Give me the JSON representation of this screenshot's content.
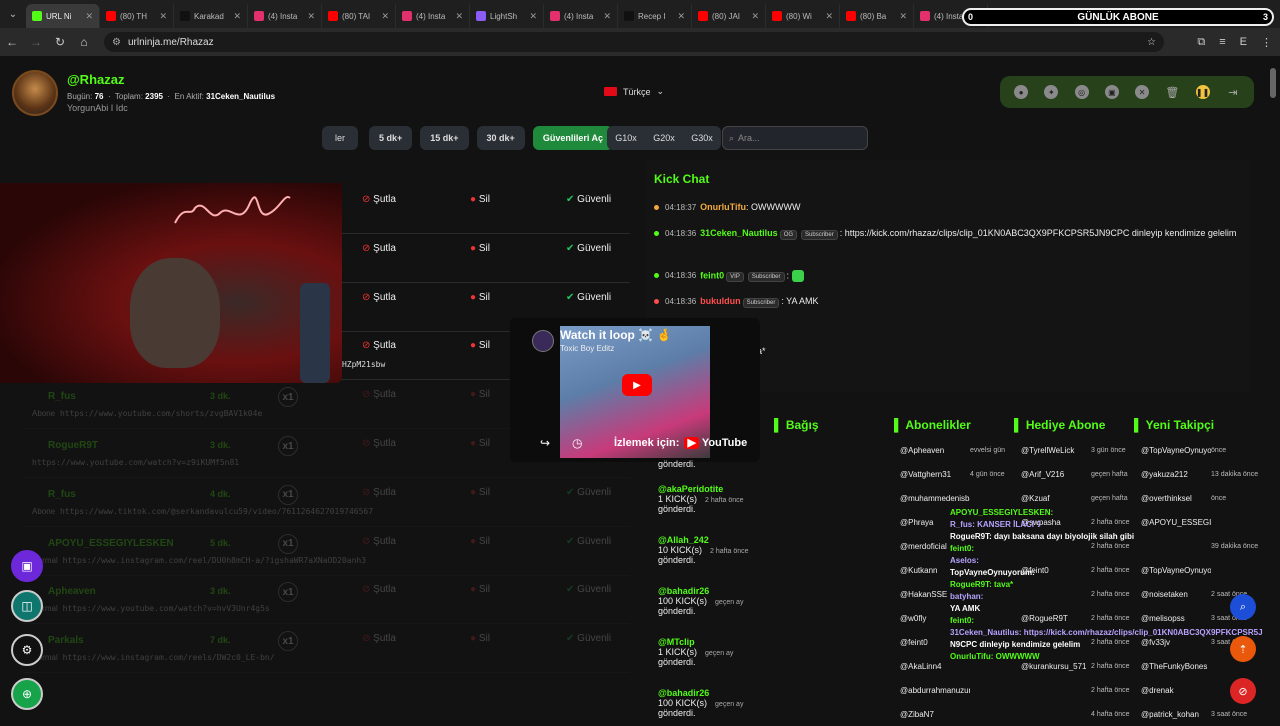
{
  "browser": {
    "tabs": [
      {
        "label": "URL Ni",
        "color": "#53fc18",
        "active": true
      },
      {
        "label": "(80) TH",
        "color": "#ff0000"
      },
      {
        "label": "Karakad",
        "color": "#111"
      },
      {
        "label": "(4) Insta",
        "color": "#e1306c"
      },
      {
        "label": "(80) TAI",
        "color": "#ff0000"
      },
      {
        "label": "(4) Insta",
        "color": "#e1306c"
      },
      {
        "label": "LightSh",
        "color": "#8b5cf6"
      },
      {
        "label": "(4) Insta",
        "color": "#e1306c"
      },
      {
        "label": "Recep I",
        "color": "#111"
      },
      {
        "label": "(80) JAI",
        "color": "#ff0000"
      },
      {
        "label": "(80) Wi",
        "color": "#ff0000"
      },
      {
        "label": "(80) Ba",
        "color": "#ff0000"
      },
      {
        "label": "(4) Insta",
        "color": "#e1306c"
      }
    ],
    "url": "urlninja.me/Rhazaz",
    "overlay_banner": "GÜNLÜK ABONE",
    "overlay_left": "0",
    "overlay_right": "3",
    "profile_initial": "E"
  },
  "header": {
    "username": "@Rhazaz",
    "today_label": "Bugün:",
    "today_value": "76",
    "total_label": "Toplam:",
    "total_value": "2395",
    "active_label": "En Aktif:",
    "active_value": "31Ceken_Nautilus",
    "subtitle": "YorgunAbi I Idc",
    "language": "Türkçe"
  },
  "toolbar": {
    "partial_label": "ler",
    "buttons": [
      "5 dk+",
      "15 dk+",
      "30 dk+"
    ],
    "trust_button": "Güvenlileri Aç",
    "multipliers": [
      "G10x",
      "G20x",
      "G30x"
    ],
    "search_placeholder": "Ara..."
  },
  "actions": {
    "report": "Şutla",
    "delete": "Sil",
    "trust": "Güvenli"
  },
  "rows": [
    {
      "name": "",
      "dk": "",
      "x": "",
      "type": "",
      "link": "9CPC",
      "faded": false
    },
    {
      "name": "",
      "dk": "",
      "x": "",
      "type": "",
      "link": "",
      "faded": false
    },
    {
      "name": "",
      "dk": "",
      "x": "",
      "type": "Normal",
      "link": "https://www.youtube.com/shorts/ombsPbzkgcU",
      "faded": false
    },
    {
      "name": "APOYU_ESSEGIYLESKEN",
      "dk": "2 dk.",
      "x": "x1",
      "type": "Normal",
      "link": "https://www.instagram.com/reel/DR5SWO6CK0o/?igsh=MWs2aWRzeHZpM21sbw",
      "faded": false
    },
    {
      "name": "R_fus",
      "dk": "3 dk.",
      "x": "x1",
      "type": "Abone",
      "link": "https://www.youtube.com/shorts/zvgBAV1k04e",
      "faded": true
    },
    {
      "name": "RogueR9T",
      "dk": "3 dk.",
      "x": "x1",
      "type": "",
      "link": "https://www.youtube.com/watch?v=z9iKUMf5n81",
      "faded": true
    },
    {
      "name": "R_fus",
      "dk": "4 dk.",
      "x": "x1",
      "type": "Abone",
      "link": "https://www.tiktok.com/@serkandavulcu59/video/7611264627019746567",
      "faded": true
    },
    {
      "name": "APOYU_ESSEGIYLESKEN",
      "dk": "5 dk.",
      "x": "x1",
      "type": "Normal",
      "link": "https://www.instagram.com/reel/DU0h8mCH-a/?igshaWR7aXNaOD20anh3",
      "faded": true
    },
    {
      "name": "Apheaven",
      "dk": "3 dk.",
      "x": "x1",
      "type": "Normal",
      "link": "https://www.youtube.com/watch?v=hvV3Unr4g5s",
      "faded": true
    },
    {
      "name": "Parkals",
      "dk": "7 dk.",
      "x": "x1",
      "type": "Normal",
      "link": "https://www.instagram.com/reels/DW2c0_LE-bn/",
      "faded": true
    }
  ],
  "chat": {
    "title": "Kick Chat",
    "messages": [
      {
        "time": "04:18:37",
        "user": "OnurluTifu",
        "color": "#f2a93b",
        "text": ": OWWWWW"
      },
      {
        "time": "04:18:36",
        "user": "31Ceken_Nautilus",
        "color": "#53fc18",
        "badges": [
          "OG",
          "Subscriber"
        ],
        "text": ": https://kick.com/rhazaz/clips/clip_01KN0ABC3QX9PFKCPSR5JN9CPC dinleyip kendimize gelelim"
      },
      {
        "time": "04:18:36",
        "user": "feint0",
        "color": "#53fc18",
        "badges": [
          "VIP",
          "Subscriber"
        ],
        "text": ":"
      },
      {
        "time": "04:18:36",
        "user": "bukuldun",
        "color": "#ff4d4d",
        "badges": [
          "Subscriber"
        ],
        "text": ": YA AMK"
      },
      {
        "time": "",
        "user": "",
        "color": "#ccc",
        "badges": [
          "Subscriber"
        ],
        "text": ":"
      },
      {
        "time": "",
        "user": "",
        "color": "#ccc",
        "badges": [
          "Founder",
          "Subscriber"
        ],
        "text": ": tava*"
      },
      {
        "time": "",
        "user": "uyorum",
        "color": "#f2a93b",
        "text": ":"
      }
    ]
  },
  "youtube_popup": {
    "title": "Watch it loop ☠️ 🤞",
    "channel": "Toxic Boy Editz",
    "watch_label": "İzlemek için:",
    "brand": "YouTube"
  },
  "sections": {
    "donation": "Bağış",
    "subscribers": "Abonelikler",
    "gift": "Hediye Abone",
    "followers": "Yeni Takipçi"
  },
  "kicks": [
    {
      "user": "",
      "amount": "",
      "text": "gönderdi.",
      "ago": ""
    },
    {
      "user": "@akaPeridotite",
      "amount": "1 KICK(s)",
      "text": "gönderdi.",
      "ago": "2 hafta önce"
    },
    {
      "user": "@Allah_242",
      "amount": "10 KICK(s)",
      "text": "gönderdi.",
      "ago": "2 hafta önce"
    },
    {
      "user": "@bahadir26",
      "amount": "100 KICK(s)",
      "text": "gönderdi.",
      "ago": "geçen ay"
    },
    {
      "user": "@MTclip",
      "amount": "1 KICK(s)",
      "text": "gönderdi.",
      "ago": "geçen ay"
    },
    {
      "user": "@bahadir26",
      "amount": "100 KICK(s)",
      "text": "gönderdi.",
      "ago": "geçen ay"
    }
  ],
  "subscribers": [
    {
      "u": "@Apheaven",
      "t": "evvelsi gün"
    },
    {
      "u": "@Vattghern31",
      "t": "4 gün önce"
    },
    {
      "u": "@muhammedenisbastanefendihz",
      "t": ""
    },
    {
      "u": "@Phraya",
      "t": ""
    },
    {
      "u": "@merdoficial",
      "t": ""
    },
    {
      "u": "@Kutkann",
      "t": ""
    },
    {
      "u": "@HakanSSE",
      "t": ""
    },
    {
      "u": "@w0fly",
      "t": ""
    },
    {
      "u": "@feint0",
      "t": ""
    },
    {
      "u": "@AkaLinn4",
      "t": ""
    },
    {
      "u": "@abdurrahmanuzun",
      "t": ""
    },
    {
      "u": "@ZibaN7",
      "t": ""
    }
  ],
  "gifts": [
    {
      "u": "@TyrellWeLick",
      "t": "3 gün önce"
    },
    {
      "u": "@Arif_V216",
      "t": "geçen hafta"
    },
    {
      "u": "@Kzuaf",
      "t": "geçen hafta"
    },
    {
      "u": "@swpasha",
      "t": "2 hafta önce"
    },
    {
      "u": "",
      "t": "2 hafta önce"
    },
    {
      "u": "@feint0",
      "t": "2 hafta önce"
    },
    {
      "u": "",
      "t": "2 hafta önce"
    },
    {
      "u": "@RogueR9T",
      "t": "2 hafta önce"
    },
    {
      "u": "",
      "t": "2 hafta önce"
    },
    {
      "u": "@kurankursu_571",
      "t": "2 hafta önce"
    },
    {
      "u": "",
      "t": "2 hafta önce"
    },
    {
      "u": "",
      "t": "4 hafta önce"
    }
  ],
  "followers": [
    {
      "u": "@TopVayneOynuyorum",
      "t": "önce"
    },
    {
      "u": "@yakuza212",
      "t": "13 dakika önce"
    },
    {
      "u": "@overthinksel",
      "t": "önce"
    },
    {
      "u": "@APOYU_ESSEGIYLESKEN",
      "t": ""
    },
    {
      "u": "",
      "t": "39 dakika önce"
    },
    {
      "u": "@TopVayneOynuyorum",
      "t": ""
    },
    {
      "u": "@noisetaken",
      "t": "2 saat önce"
    },
    {
      "u": "@melisopss",
      "t": "3 saat önce"
    },
    {
      "u": "@fv33jv",
      "t": "3 saat önce"
    },
    {
      "u": "@TheFunkyBones",
      "t": ""
    },
    {
      "u": "@drenak",
      "t": ""
    },
    {
      "u": "@patrick_kohan",
      "t": "3 saat önce"
    }
  ],
  "overlay_chat": [
    "APOYU_ESSEGIYLESKEN:",
    "R_fus: KANSER İLACI ?",
    "RogueR9T: dayı baksana dayı biyolojik silah gibi",
    "feint0:",
    "Aselos:",
    "TopVayneOynuyorum:",
    "RogueR9T: tava*",
    "batyhan:",
    "YA AMK",
    "feint0:",
    "31Ceken_Nautilus: https://kick.com/rhazaz/clips/clip_01KN0ABC3QX9PFKCPSR5J",
    "N9CPC dinleyip kendimize gelelim",
    "OnurluTifu: OWWWWW"
  ]
}
